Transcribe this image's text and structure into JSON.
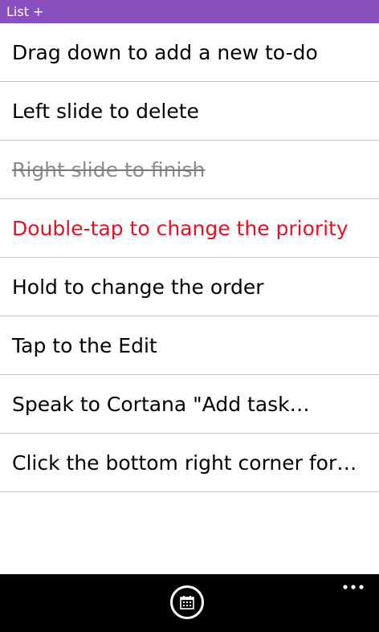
{
  "title_bar": {
    "title": "List +"
  },
  "tasks": [
    {
      "text": "Drag down to add a new to-do",
      "state": "normal"
    },
    {
      "text": "Left slide to delete",
      "state": "normal"
    },
    {
      "text": "Right slide to finish",
      "state": "completed"
    },
    {
      "text": "Double-tap to change the priority",
      "state": "priority"
    },
    {
      "text": "Hold to change the order",
      "state": "normal"
    },
    {
      "text": "Tap to the Edit",
      "state": "normal"
    },
    {
      "text": "Speak to Cortana \"Add task…",
      "state": "normal"
    },
    {
      "text": "Click the bottom right corner for…",
      "state": "normal"
    }
  ],
  "app_bar": {
    "primary_icon": "calendar-icon",
    "overflow_icon": "more-icon"
  },
  "colors": {
    "accent": "#8a4fbf",
    "priority": "#e81123",
    "completed": "#8c8c8c",
    "app_bar": "#000000"
  }
}
